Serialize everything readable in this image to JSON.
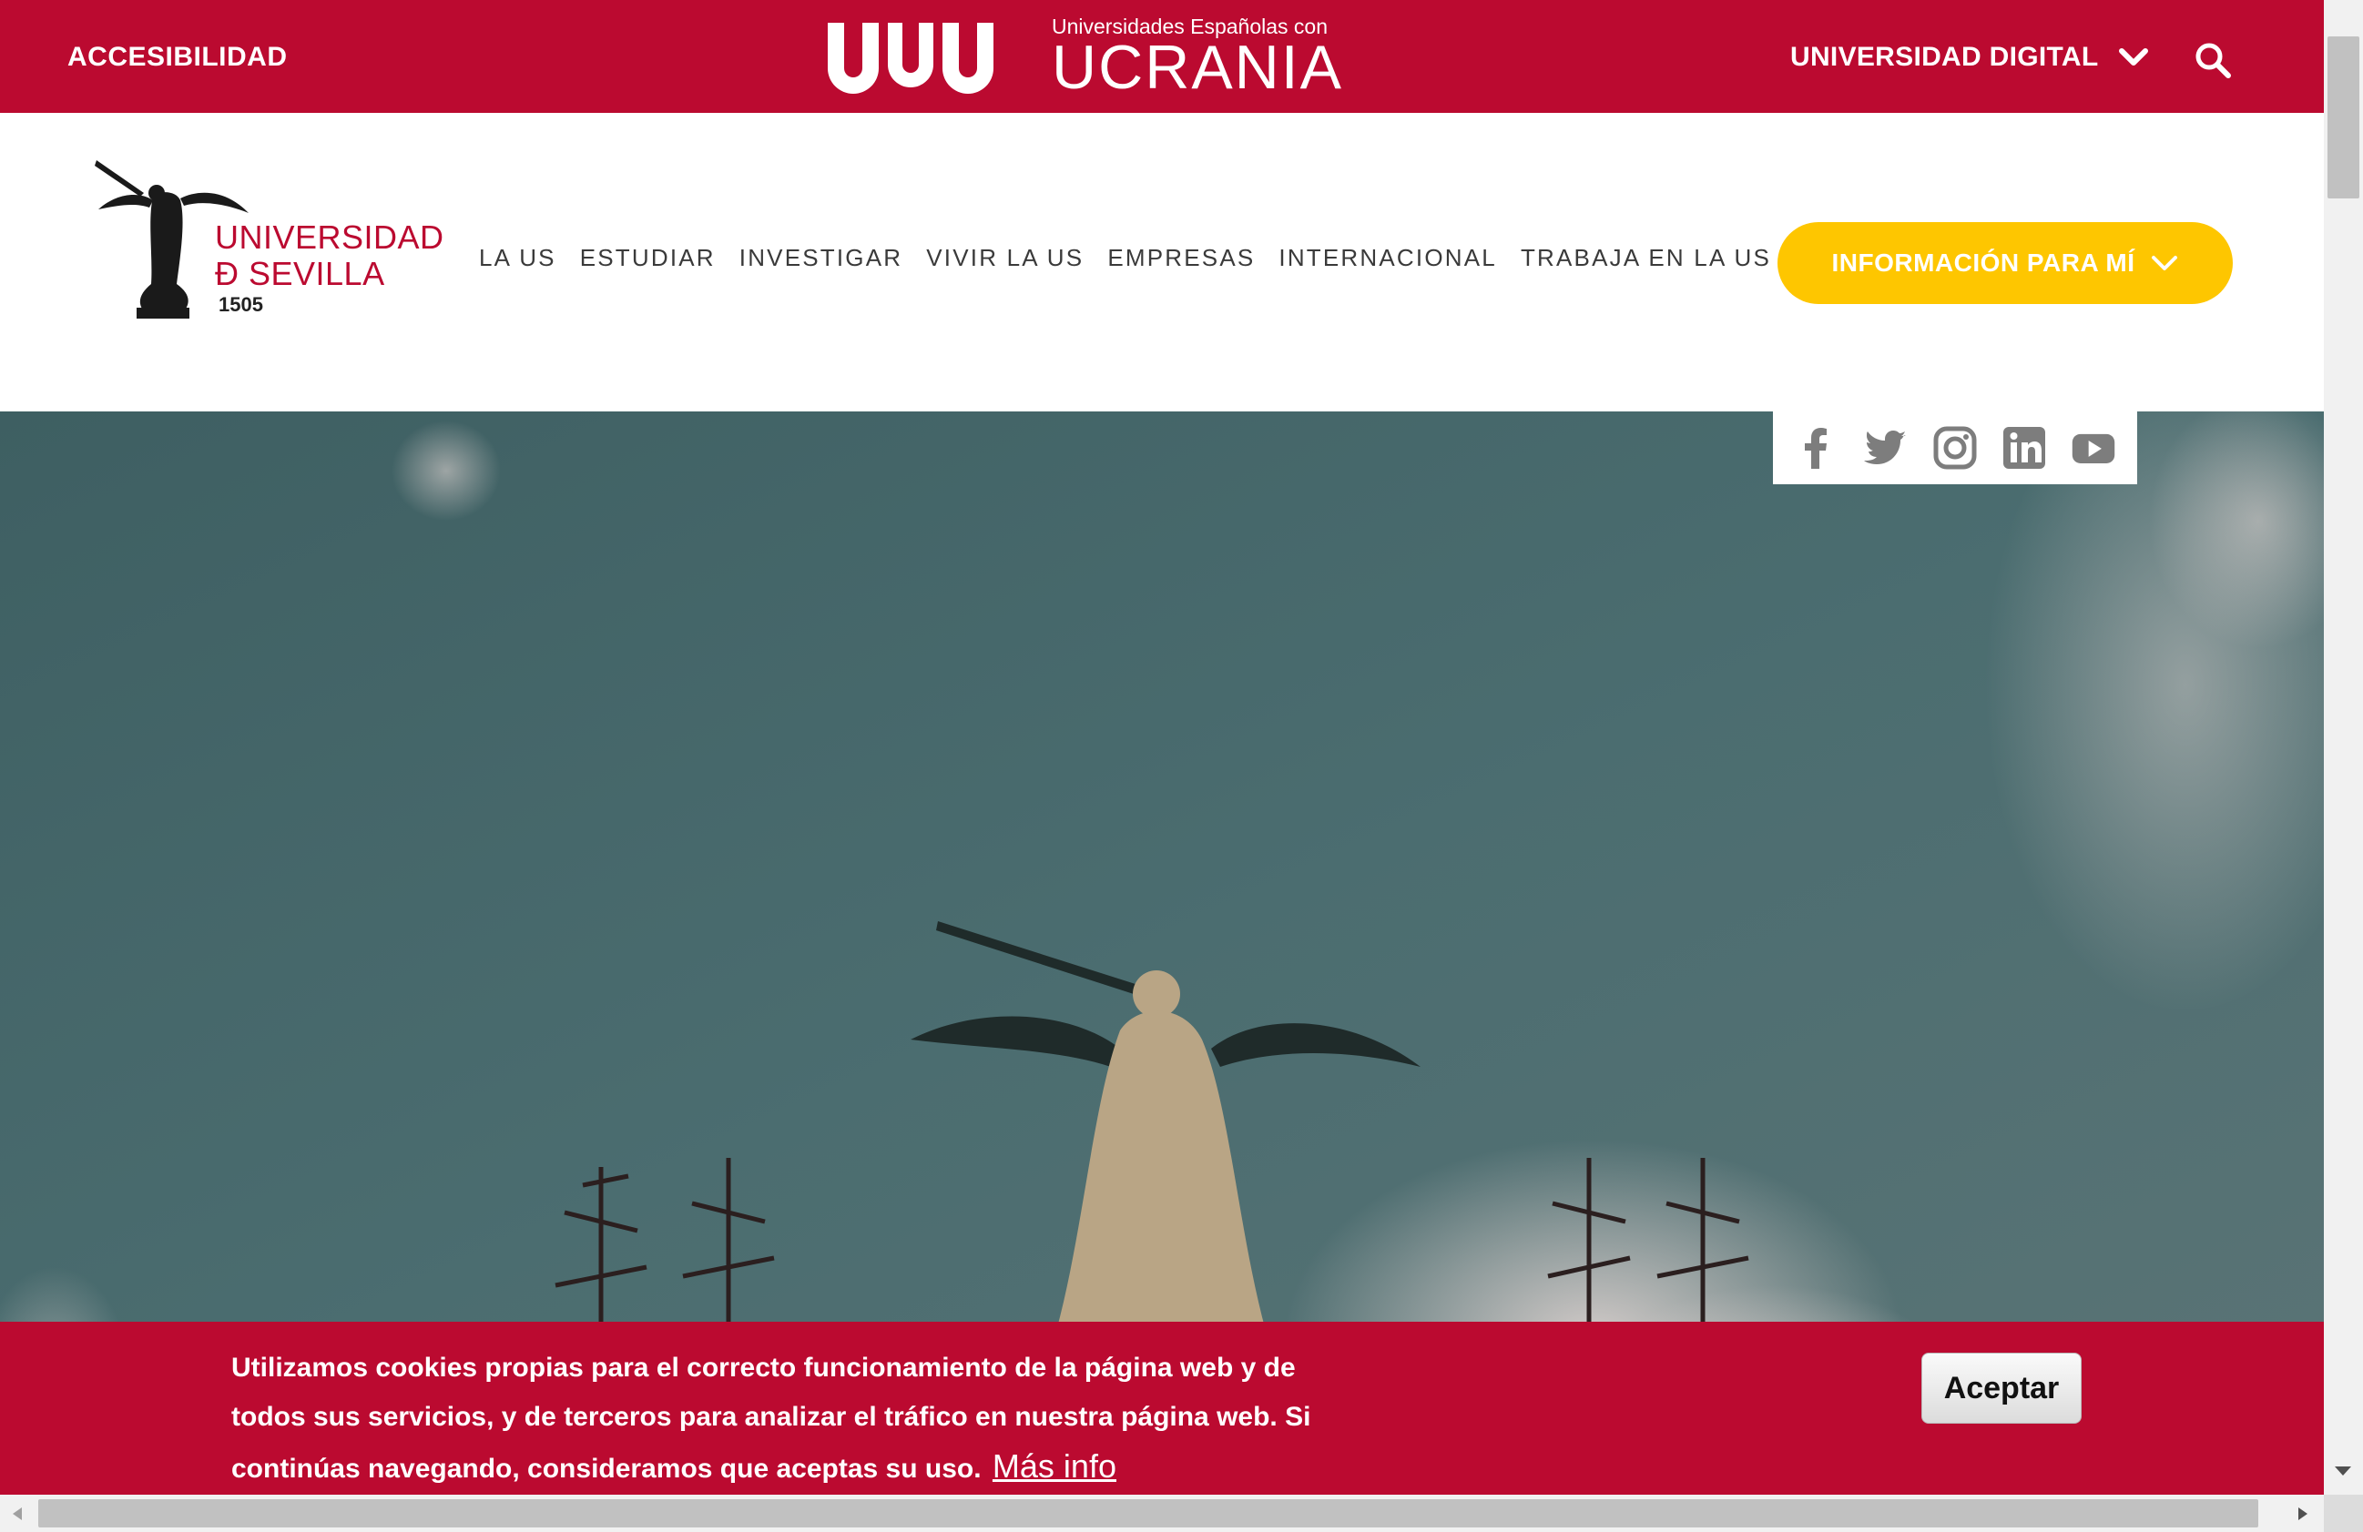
{
  "topbar": {
    "accessibility": "ACCESIBILIDAD",
    "ukraine_small": "Universidades Españolas con",
    "ukraine_big": "UCRANIA",
    "digital": "UNIVERSIDAD DIGITAL"
  },
  "header": {
    "logo_line1": "UNIVERSIDAD",
    "logo_line2": "Ð SEVILLA",
    "logo_year": "1505",
    "nav": [
      "LA US",
      "ESTUDIAR",
      "INVESTIGAR",
      "VIVIR LA US",
      "EMPRESAS",
      "INTERNACIONAL",
      "TRABAJA EN LA US"
    ],
    "info_button": "INFORMACIÓN PARA MÍ"
  },
  "social": [
    "facebook-icon",
    "twitter-icon",
    "instagram-icon",
    "linkedin-icon",
    "youtube-icon"
  ],
  "cookie": {
    "message": "Utilizamos cookies propias para el correcto funcionamiento de la página web y de todos sus servicios, y de terceros para analizar el tráfico en nuestra página web. Si continúas navegando, consideramos que aceptas su uso.",
    "more_link": "Más info",
    "accept": "Aceptar"
  },
  "colors": {
    "brand_red": "#bb0a30",
    "accent_yellow": "#fec600"
  }
}
